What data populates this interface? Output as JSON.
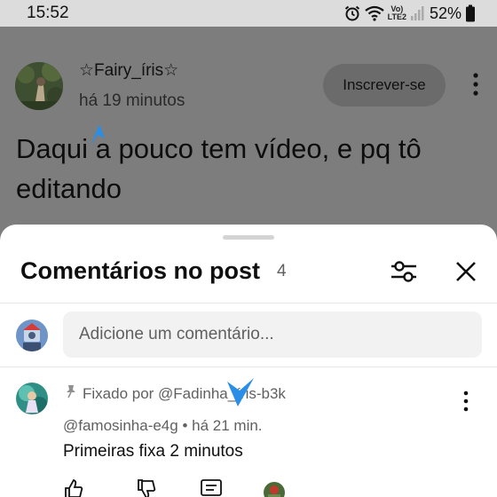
{
  "status_bar": {
    "time": "15:52",
    "network_label_top": "Vo)",
    "network_label_bottom": "LTE2",
    "battery_percent": "52%",
    "icons": [
      "alarm-icon",
      "wifi-icon",
      "signal-icon",
      "battery-icon"
    ]
  },
  "post": {
    "author": "☆Fairy_íris☆",
    "time": "há 19 minutos",
    "subscribe_label": "Inscrever-se",
    "text": "Daqui a pouco tem vídeo, e pq tô editando"
  },
  "comments_sheet": {
    "title": "Comentários no post",
    "count": "4",
    "input_placeholder": "Adicione um comentário...",
    "comment": {
      "pinned_label": "Fixado por @Fadinha_íris-b3k",
      "author": "@famosinha-e4g",
      "separator": "•",
      "time": "há 21 min.",
      "text": "Primeiras fixa 2 minutos"
    },
    "actions": [
      "like-icon",
      "dislike-icon",
      "reply-icon",
      "avatar"
    ]
  },
  "colors": {
    "overlay_gray": "#7e7e7e",
    "sheet_bg": "#ffffff",
    "input_bg": "#f2f2f2",
    "secondary_text": "#606060",
    "cursor_blue": "#2b8ee6"
  }
}
